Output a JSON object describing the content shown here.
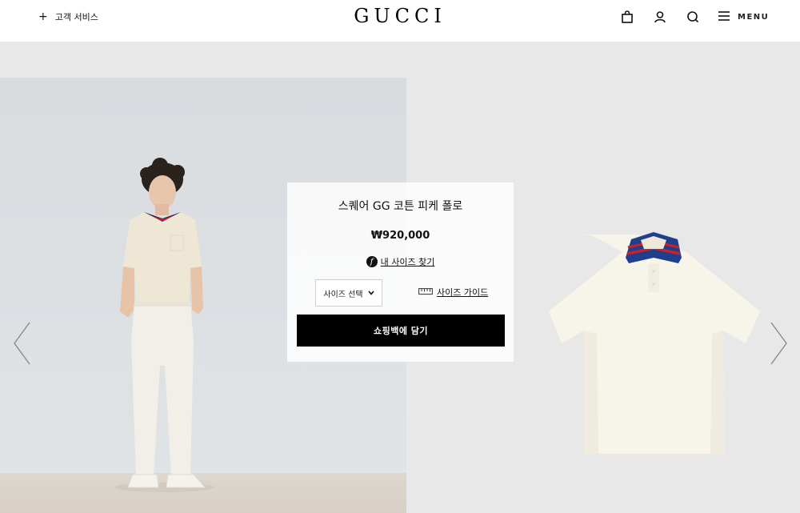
{
  "header": {
    "customer_service": "고객 서비스",
    "plus_glyph": "+",
    "logo": "GUCCI",
    "menu_label": "MENU",
    "icons": [
      "shopping-bag-icon",
      "account-icon",
      "search-icon",
      "hamburger-icon"
    ]
  },
  "product": {
    "title": "스퀘어 GG 코튼 피케 폴로",
    "price": "₩920,000",
    "find_size_badge": "f",
    "find_size": "내 사이즈 찾기",
    "size_select": "사이즈 선택",
    "size_guide": "사이즈 가이드",
    "add_to_bag": "쇼핑백에 담기"
  },
  "colors": {
    "stage_bg": "#e8e8e9",
    "model_bg": "#dadee1",
    "button_bg": "#000000",
    "collar_blue": "#1f3f8c",
    "collar_red": "#c8232c"
  }
}
